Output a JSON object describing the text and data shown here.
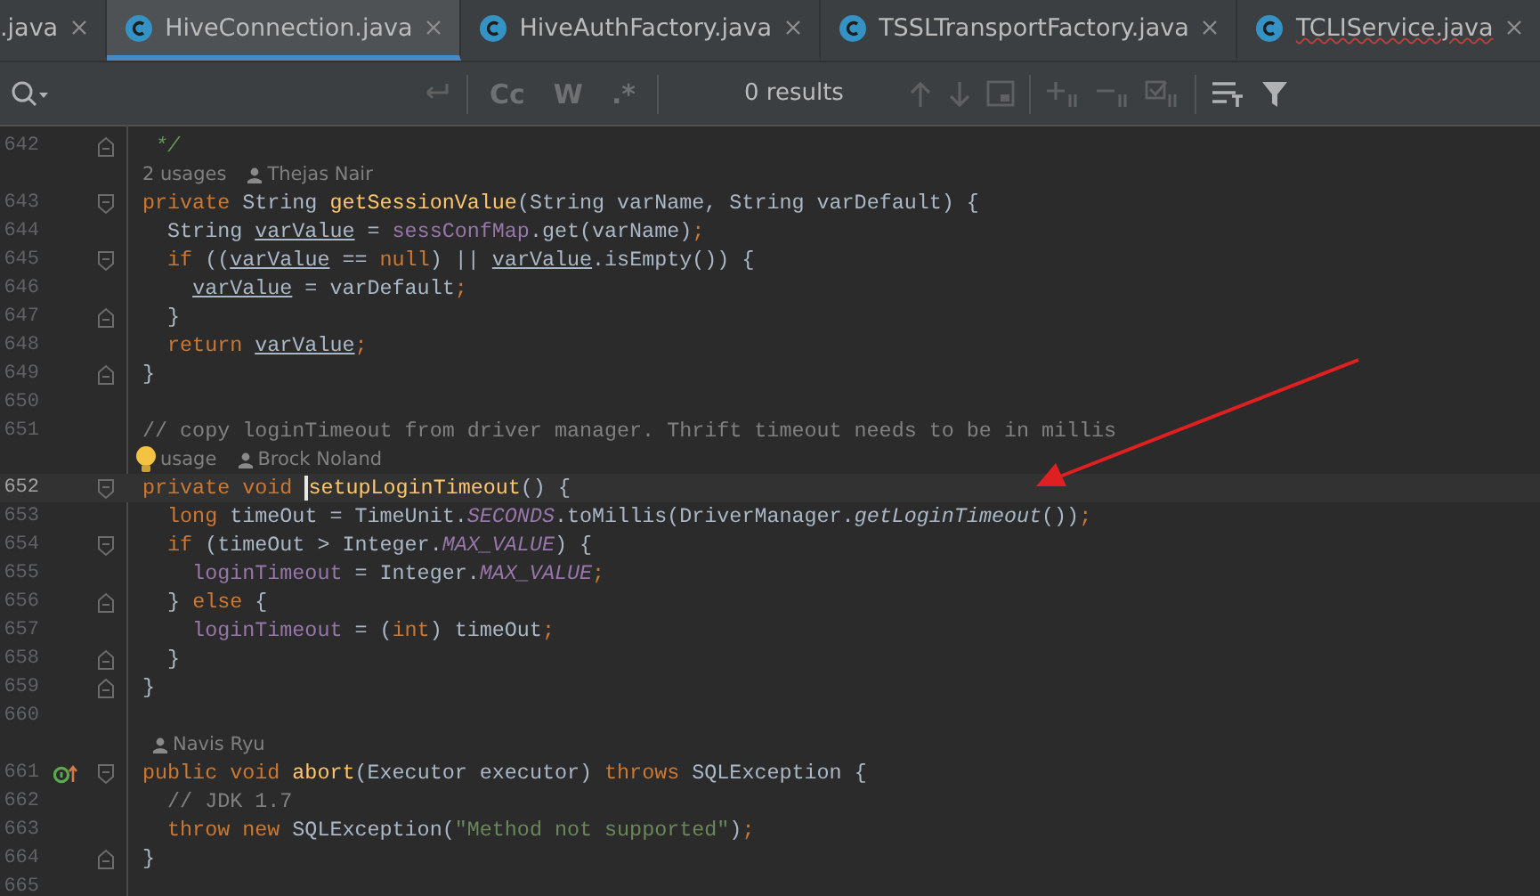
{
  "tabs": [
    {
      "label": ".java",
      "selected": false,
      "cut": true,
      "error": false
    },
    {
      "label": "HiveConnection.java",
      "selected": true,
      "cut": false,
      "error": false
    },
    {
      "label": "HiveAuthFactory.java",
      "selected": false,
      "cut": false,
      "error": false
    },
    {
      "label": "TSSLTransportFactory.java",
      "selected": false,
      "cut": false,
      "error": false
    },
    {
      "label": "TCLIService.java",
      "selected": false,
      "cut": false,
      "error": true
    }
  ],
  "find_bar": {
    "toggles": [
      "Cc",
      "W",
      ".*"
    ],
    "results": "0 results"
  },
  "editor": {
    "lines": [
      {
        "kind": "code",
        "number": "642",
        "current": false,
        "fold_start": false,
        "fold_end": true,
        "implemented": false,
        "tokens": [
          {
            "kind": "doc",
            "text": " */"
          }
        ]
      },
      {
        "kind": "hint",
        "usages": "2 usages",
        "author": "Thejas Nair",
        "bulb": false
      },
      {
        "kind": "code",
        "number": "643",
        "current": false,
        "fold_start": true,
        "fold_end": false,
        "implemented": false,
        "tokens": [
          {
            "kind": "kw",
            "text": "private "
          },
          {
            "kind": "plain",
            "text": "String "
          },
          {
            "kind": "fn",
            "text": "getSessionValue"
          },
          {
            "kind": "plain",
            "text": "(String varName, String varDefault) {"
          }
        ]
      },
      {
        "kind": "code",
        "number": "644",
        "current": false,
        "fold_start": false,
        "fold_end": false,
        "implemented": false,
        "tokens": [
          {
            "kind": "plain",
            "text": "  String "
          },
          {
            "kind": "var",
            "text": "varValue"
          },
          {
            "kind": "plain",
            "text": " = "
          },
          {
            "kind": "field",
            "text": "sessConfMap"
          },
          {
            "kind": "plain",
            "text": ".get(varName)"
          },
          {
            "kind": "kw",
            "text": ";"
          }
        ]
      },
      {
        "kind": "code",
        "number": "645",
        "current": false,
        "fold_start": true,
        "fold_end": false,
        "implemented": false,
        "tokens": [
          {
            "kind": "kw",
            "text": "  if "
          },
          {
            "kind": "plain",
            "text": "(("
          },
          {
            "kind": "var",
            "text": "varValue"
          },
          {
            "kind": "plain",
            "text": " == "
          },
          {
            "kind": "kw",
            "text": "null"
          },
          {
            "kind": "plain",
            "text": ") || "
          },
          {
            "kind": "var",
            "text": "varValue"
          },
          {
            "kind": "plain",
            "text": ".isEmpty()) {"
          }
        ]
      },
      {
        "kind": "code",
        "number": "646",
        "current": false,
        "fold_start": false,
        "fold_end": false,
        "implemented": false,
        "tokens": [
          {
            "kind": "var",
            "text": "    varValue"
          },
          {
            "kind": "plain",
            "text": " = varDefault"
          },
          {
            "kind": "kw",
            "text": ";"
          }
        ]
      },
      {
        "kind": "code",
        "number": "647",
        "current": false,
        "fold_start": false,
        "fold_end": true,
        "implemented": false,
        "tokens": [
          {
            "kind": "plain",
            "text": "  }"
          }
        ]
      },
      {
        "kind": "code",
        "number": "648",
        "current": false,
        "fold_start": false,
        "fold_end": false,
        "implemented": false,
        "tokens": [
          {
            "kind": "kw",
            "text": "  return "
          },
          {
            "kind": "var",
            "text": "varValue"
          },
          {
            "kind": "kw",
            "text": ";"
          }
        ]
      },
      {
        "kind": "code",
        "number": "649",
        "current": false,
        "fold_start": false,
        "fold_end": true,
        "implemented": false,
        "tokens": [
          {
            "kind": "plain",
            "text": "}"
          }
        ]
      },
      {
        "kind": "code",
        "number": "650",
        "current": false,
        "fold_start": false,
        "fold_end": false,
        "implemented": false
      },
      {
        "kind": "code",
        "number": "651",
        "current": false,
        "fold_start": false,
        "fold_end": false,
        "implemented": false,
        "tokens": [
          {
            "kind": "comment",
            "text": "// copy loginTimeout from driver manager. Thrift timeout needs to be in millis"
          }
        ]
      },
      {
        "kind": "hint",
        "usages": "usage",
        "author": "Brock Noland",
        "bulb": true
      },
      {
        "kind": "code",
        "number": "652",
        "current": true,
        "fold_start": true,
        "fold_end": false,
        "implemented": false,
        "tokens": [
          {
            "kind": "kw",
            "text": "private void ",
            "caret": false
          },
          {
            "kind": "fn",
            "text": "setupLoginTimeout",
            "caret": true
          },
          {
            "kind": "plain",
            "text": "() {",
            "caret": false
          }
        ]
      },
      {
        "kind": "code",
        "number": "653",
        "current": false,
        "fold_start": false,
        "fold_end": false,
        "implemented": false,
        "tokens": [
          {
            "kind": "kw",
            "text": "  long "
          },
          {
            "kind": "plain",
            "text": "timeOut = TimeUnit."
          },
          {
            "kind": "static",
            "text": "SECONDS"
          },
          {
            "kind": "plain",
            "text": ".toMillis(DriverManager."
          },
          {
            "kind": "italic",
            "text": "getLoginTimeout"
          },
          {
            "kind": "plain",
            "text": "())"
          },
          {
            "kind": "kw",
            "text": ";"
          }
        ]
      },
      {
        "kind": "code",
        "number": "654",
        "current": false,
        "fold_start": true,
        "fold_end": false,
        "implemented": false,
        "tokens": [
          {
            "kind": "kw",
            "text": "  if "
          },
          {
            "kind": "plain",
            "text": "(timeOut > Integer."
          },
          {
            "kind": "static",
            "text": "MAX_VALUE"
          },
          {
            "kind": "plain",
            "text": ") {"
          }
        ]
      },
      {
        "kind": "code",
        "number": "655",
        "current": false,
        "fold_start": false,
        "fold_end": false,
        "implemented": false,
        "tokens": [
          {
            "kind": "field",
            "text": "    loginTimeout"
          },
          {
            "kind": "plain",
            "text": " = Integer."
          },
          {
            "kind": "static",
            "text": "MAX_VALUE"
          },
          {
            "kind": "kw",
            "text": ";"
          }
        ]
      },
      {
        "kind": "code",
        "number": "656",
        "current": false,
        "fold_start": false,
        "fold_end": true,
        "implemented": false,
        "tokens": [
          {
            "kind": "plain",
            "text": "  } "
          },
          {
            "kind": "kw",
            "text": "else "
          },
          {
            "kind": "plain",
            "text": "{"
          }
        ]
      },
      {
        "kind": "code",
        "number": "657",
        "current": false,
        "fold_start": false,
        "fold_end": false,
        "implemented": false,
        "tokens": [
          {
            "kind": "field",
            "text": "    loginTimeout"
          },
          {
            "kind": "plain",
            "text": " = ("
          },
          {
            "kind": "kw",
            "text": "int"
          },
          {
            "kind": "plain",
            "text": ") timeOut"
          },
          {
            "kind": "kw",
            "text": ";"
          }
        ]
      },
      {
        "kind": "code",
        "number": "658",
        "current": false,
        "fold_start": false,
        "fold_end": true,
        "implemented": false,
        "tokens": [
          {
            "kind": "plain",
            "text": "  }"
          }
        ]
      },
      {
        "kind": "code",
        "number": "659",
        "current": false,
        "fold_start": false,
        "fold_end": true,
        "implemented": false,
        "tokens": [
          {
            "kind": "plain",
            "text": "}"
          }
        ]
      },
      {
        "kind": "code",
        "number": "660",
        "current": false,
        "fold_start": false,
        "fold_end": false,
        "implemented": false
      },
      {
        "kind": "hint",
        "author": "Navis Ryu",
        "bulb": false
      },
      {
        "kind": "code",
        "number": "661",
        "current": false,
        "fold_start": true,
        "fold_end": false,
        "implemented": true,
        "tokens": [
          {
            "kind": "kw",
            "text": "public void "
          },
          {
            "kind": "fn",
            "text": "abort"
          },
          {
            "kind": "plain",
            "text": "(Executor executor) "
          },
          {
            "kind": "kw",
            "text": "throws "
          },
          {
            "kind": "plain",
            "text": "SQLException {"
          }
        ]
      },
      {
        "kind": "code",
        "number": "662",
        "current": false,
        "fold_start": false,
        "fold_end": false,
        "implemented": false,
        "tokens": [
          {
            "kind": "comment",
            "text": "  // JDK 1.7"
          }
        ]
      },
      {
        "kind": "code",
        "number": "663",
        "current": false,
        "fold_start": false,
        "fold_end": false,
        "implemented": false,
        "tokens": [
          {
            "kind": "kw",
            "text": "  throw new "
          },
          {
            "kind": "plain",
            "text": "SQLException("
          },
          {
            "kind": "str",
            "text": "\"Method not supported\""
          },
          {
            "kind": "plain",
            "text": ")"
          },
          {
            "kind": "kw",
            "text": ";"
          }
        ]
      },
      {
        "kind": "code",
        "number": "664",
        "current": false,
        "fold_start": false,
        "fold_end": true,
        "implemented": false,
        "tokens": [
          {
            "kind": "plain",
            "text": "}"
          }
        ]
      },
      {
        "kind": "code",
        "number": "665",
        "current": false,
        "fold_start": false,
        "fold_end": false,
        "implemented": false
      }
    ]
  }
}
